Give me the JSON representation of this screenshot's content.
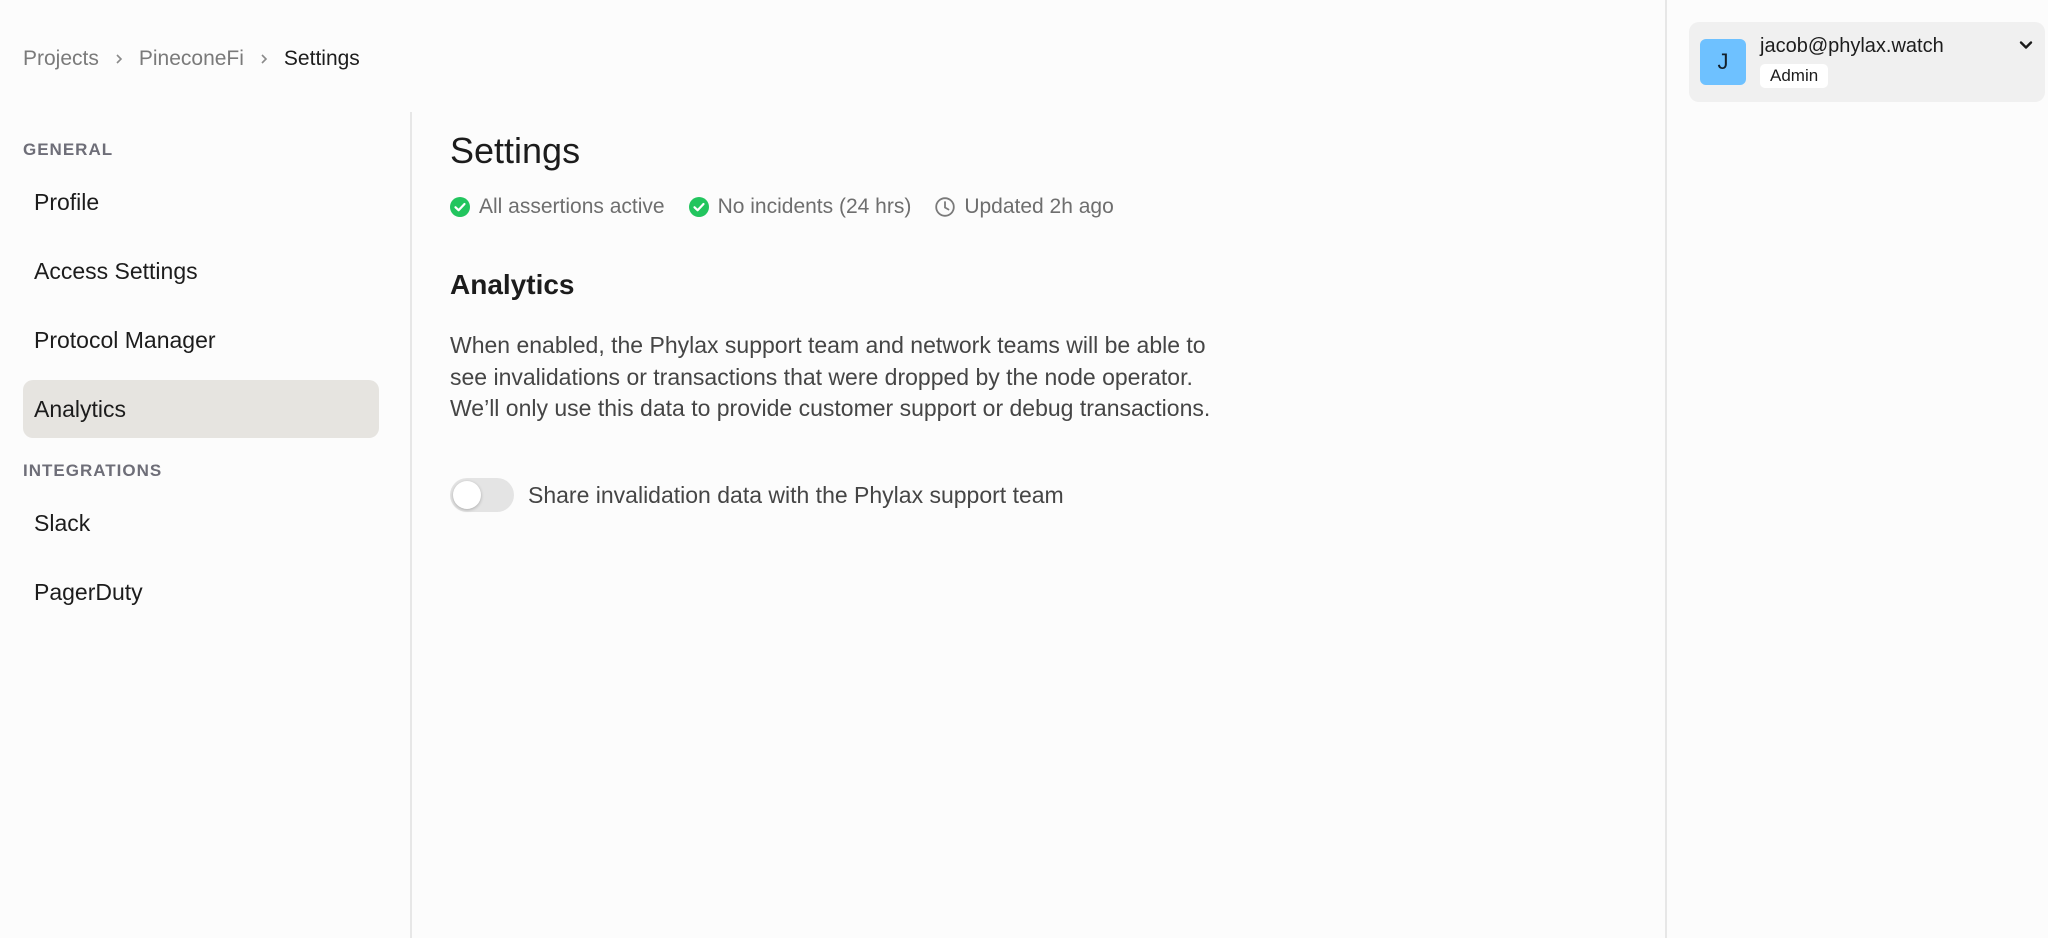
{
  "breadcrumb": {
    "items": [
      "Projects",
      "PineconeFi",
      "Settings"
    ]
  },
  "sidebar": {
    "general_label": "GENERAL",
    "integrations_label": "INTEGRATIONS",
    "general_items": [
      {
        "label": "Profile"
      },
      {
        "label": "Access Settings"
      },
      {
        "label": "Protocol Manager"
      },
      {
        "label": "Analytics",
        "active": true
      }
    ],
    "integration_items": [
      {
        "label": "Slack"
      },
      {
        "label": "PagerDuty"
      }
    ]
  },
  "main": {
    "title": "Settings",
    "statuses": [
      {
        "icon": "check-circle-icon",
        "text": "All assertions active"
      },
      {
        "icon": "check-circle-icon",
        "text": "No incidents (24 hrs)"
      },
      {
        "icon": "clock-icon",
        "text": "Updated 2h ago"
      }
    ],
    "section_title": "Analytics",
    "description": "When enabled, the Phylax support team and network teams will be able to see invalidations or transactions that were dropped by the node operator. We’ll only use this data to provide customer support or debug transactions.",
    "toggle": {
      "label": "Share invalidation data with the Phylax support team",
      "checked": false
    }
  },
  "user": {
    "avatar_letter": "J",
    "email": "jacob@phylax.watch",
    "role": "Admin"
  },
  "colors": {
    "success": "#22c55e",
    "avatar_bg": "#6ec1ff",
    "active_nav_bg": "#e6e4e0"
  }
}
